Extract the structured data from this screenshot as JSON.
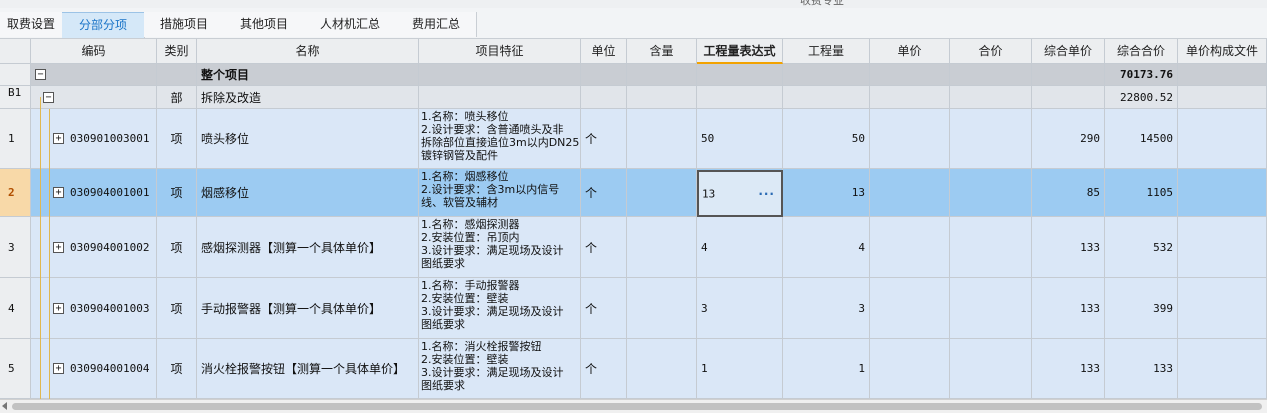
{
  "title": "收费专业",
  "tabs": [
    {
      "label": "取费设置"
    },
    {
      "label": "分部分项"
    },
    {
      "label": "措施项目"
    },
    {
      "label": "其他项目"
    },
    {
      "label": "人材机汇总"
    },
    {
      "label": "费用汇总"
    }
  ],
  "columns": {
    "code": "编码",
    "type": "类别",
    "name": "名称",
    "feature": "项目特征",
    "unit": "单位",
    "content": "含量",
    "qty_expr": "工程量表达式",
    "qty": "工程量",
    "price": "单价",
    "amount": "合价",
    "unit_total": "综合单价",
    "total": "综合合价",
    "price_file": "单价构成文件"
  },
  "total_row": {
    "expand": "−",
    "name": "整个项目",
    "total": "70173.76"
  },
  "section_row": {
    "rownum": "B1",
    "expand": "−",
    "type": "部",
    "name": "拆除及改造",
    "total": "22800.52"
  },
  "rows": [
    {
      "rownum": "1",
      "expand": "+",
      "code": "030901003001",
      "type": "项",
      "name": "喷头移位",
      "feature": [
        "1.名称：喷头移位",
        "2.设计要求：含普通喷头及非",
        "拆除部位直接追位3m以内DN25",
        "镀锌钢管及配件"
      ],
      "unit": "个",
      "qty_expr": "50",
      "qty": "50",
      "unit_total": "290",
      "total": "14500"
    },
    {
      "rownum": "2",
      "expand": "+",
      "code": "030904001001",
      "type": "项",
      "name": "烟感移位",
      "feature": [
        "1.名称：烟感移位",
        "2.设计要求：含3m以内信号",
        "线、软管及辅材"
      ],
      "unit": "个",
      "qty_expr": "13",
      "qty": "13",
      "unit_total": "85",
      "total": "1105",
      "ellipsis": "···"
    },
    {
      "rownum": "3",
      "expand": "+",
      "code": "030904001002",
      "type": "项",
      "name": "感烟探测器【测算一个具体单价】",
      "feature": [
        "1.名称：感烟探测器",
        "2.安装位置：吊顶内",
        "3.设计要求：满足现场及设计",
        "图纸要求"
      ],
      "unit": "个",
      "qty_expr": "4",
      "qty": "4",
      "unit_total": "133",
      "total": "532"
    },
    {
      "rownum": "4",
      "expand": "+",
      "code": "030904001003",
      "type": "项",
      "name": "手动报警器【测算一个具体单价】",
      "feature": [
        "1.名称：手动报警器",
        "2.安装位置：壁装",
        "3.设计要求：满足现场及设计",
        "图纸要求"
      ],
      "unit": "个",
      "qty_expr": "3",
      "qty": "3",
      "unit_total": "133",
      "total": "399"
    },
    {
      "rownum": "5",
      "expand": "+",
      "code": "030904001004",
      "type": "项",
      "name": "消火栓报警按钮【测算一个具体单价】",
      "feature": [
        "1.名称：消火栓报警按钮",
        "2.安装位置：壁装",
        "3.设计要求：满足现场及设计",
        "图纸要求"
      ],
      "unit": "个",
      "qty_expr": "1",
      "qty": "1",
      "unit_total": "133",
      "total": "133"
    }
  ],
  "selected_row": "2",
  "colors": {
    "selected": "#9ccbf2",
    "row": "#dae7f7",
    "tab_active": "#1a74c7"
  }
}
